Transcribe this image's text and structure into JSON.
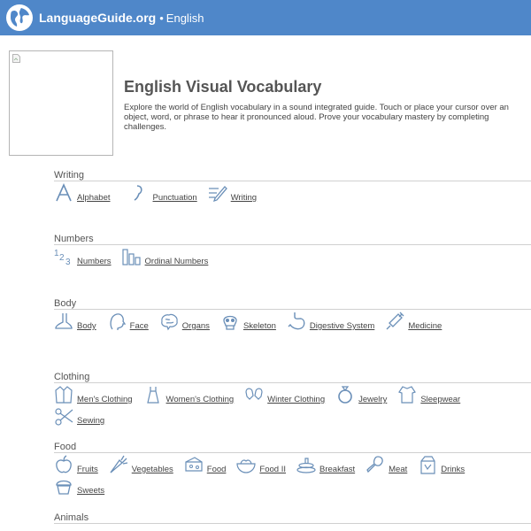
{
  "header": {
    "brand": "LanguageGuide.org",
    "separator": "•",
    "language": "English"
  },
  "intro": {
    "title": "English Visual Vocabulary",
    "description": "Explore the world of English vocabulary in a sound integrated guide. Touch or place your cursor over an object, word, or phrase to hear it pronounced aloud. Prove your vocabulary mastery by completing challenges."
  },
  "sections": {
    "writing": {
      "title": "Writing",
      "items": [
        {
          "label": "Alphabet",
          "icon": "letter-a-icon"
        },
        {
          "label": "Punctuation",
          "icon": "punctuation-icon"
        },
        {
          "label": "Writing",
          "icon": "writing-icon"
        }
      ]
    },
    "numbers": {
      "title": "Numbers",
      "items": [
        {
          "label": "Numbers",
          "icon": "numbers-123-icon"
        },
        {
          "label": "Ordinal Numbers",
          "icon": "ordinal-bars-icon"
        }
      ]
    },
    "body": {
      "title": "Body",
      "items": [
        {
          "label": "Body",
          "icon": "foot-icon"
        },
        {
          "label": "Face",
          "icon": "face-icon"
        },
        {
          "label": "Organs",
          "icon": "brain-icon"
        },
        {
          "label": "Skeleton",
          "icon": "skull-icon"
        },
        {
          "label": "Digestive System",
          "icon": "stomach-icon"
        },
        {
          "label": "Medicine",
          "icon": "syringe-icon"
        }
      ]
    },
    "clothing": {
      "title": "Clothing",
      "items": [
        {
          "label": "Men's Clothing",
          "icon": "jacket-icon"
        },
        {
          "label": "Women's Clothing",
          "icon": "dress-icon"
        },
        {
          "label": "Winter Clothing",
          "icon": "mittens-icon"
        },
        {
          "label": "Jewelry",
          "icon": "ring-icon"
        },
        {
          "label": "Sleepwear",
          "icon": "pajamas-icon"
        },
        {
          "label": "Sewing",
          "icon": "scissors-icon"
        }
      ]
    },
    "food": {
      "title": "Food",
      "items": [
        {
          "label": "Fruits",
          "icon": "apple-icon"
        },
        {
          "label": "Vegetables",
          "icon": "carrot-icon"
        },
        {
          "label": "Food",
          "icon": "cheese-icon"
        },
        {
          "label": "Food II",
          "icon": "bowl-icon"
        },
        {
          "label": "Breakfast",
          "icon": "pancakes-icon"
        },
        {
          "label": "Meat",
          "icon": "drumstick-icon"
        },
        {
          "label": "Drinks",
          "icon": "carton-icon"
        },
        {
          "label": "Sweets",
          "icon": "cupcake-icon"
        }
      ]
    },
    "animals": {
      "title": "Animals"
    }
  },
  "colors": {
    "header_bg": "#4f87c9",
    "text": "#555555",
    "rule": "#d0d0d0"
  }
}
